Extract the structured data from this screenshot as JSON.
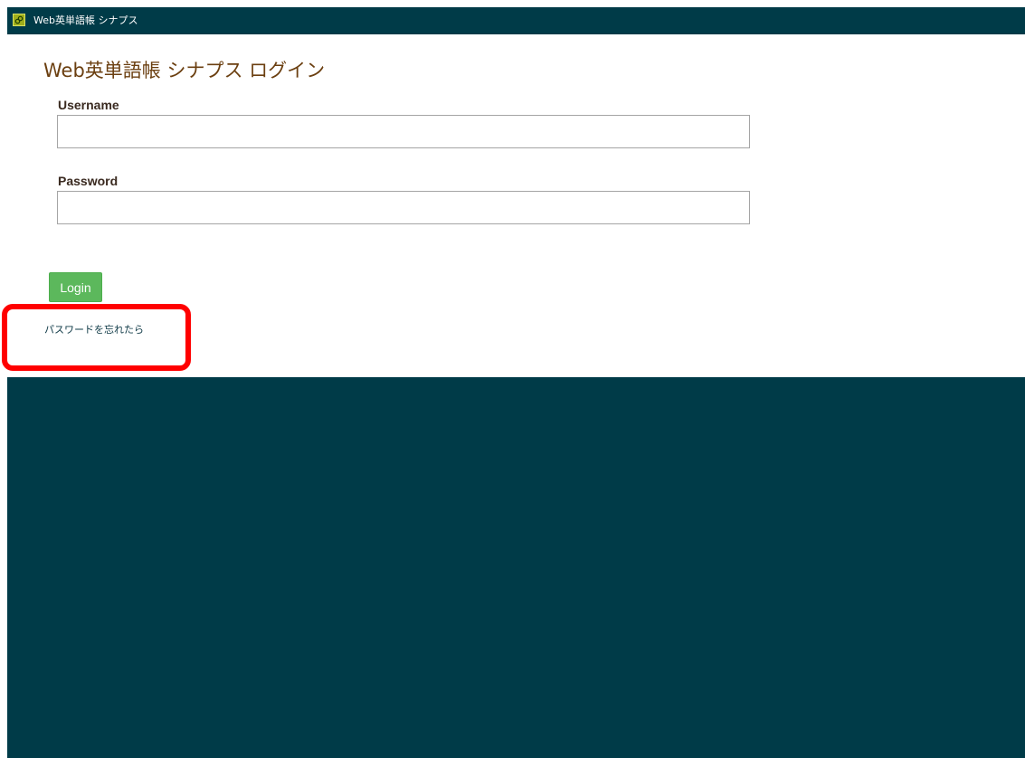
{
  "app": {
    "title": "Web英単語帳 シナプス",
    "icon": "app-logo-icon"
  },
  "login": {
    "heading": "Web英単語帳 シナプス ログイン",
    "username_label": "Username",
    "username_value": "",
    "password_label": "Password",
    "password_value": "",
    "login_button": "Login",
    "forgot_link": "パスワードを忘れたら"
  },
  "colors": {
    "frame": "#003b48",
    "title_text": "#6b3f10",
    "login_button": "#5cb85c",
    "highlight": "#ff0000"
  }
}
